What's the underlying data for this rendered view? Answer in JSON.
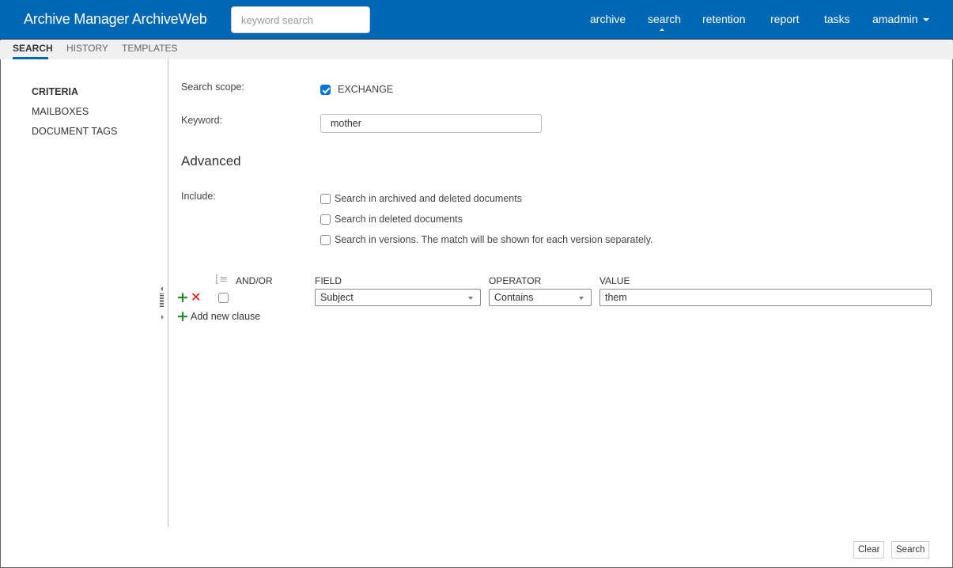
{
  "header": {
    "title": "Archive Manager ArchiveWeb",
    "search_placeholder": "keyword search",
    "nav": [
      "archive",
      "search",
      "retention",
      "report",
      "tasks"
    ],
    "active_nav": "search",
    "user": "amadmin",
    "brand_color": "#0067b4"
  },
  "subtabs": [
    "SEARCH",
    "HISTORY",
    "TEMPLATES"
  ],
  "active_subtab": "SEARCH",
  "sidebar": {
    "items": [
      "CRITERIA",
      "MAILBOXES",
      "DOCUMENT TAGS"
    ],
    "active": "CRITERIA"
  },
  "form": {
    "scope_label": "Search scope:",
    "scope_option": "EXCHANGE",
    "scope_checked": true,
    "keyword_label": "Keyword:",
    "keyword_value": "mother",
    "advanced_heading": "Advanced",
    "include_label": "Include:",
    "include_options": [
      {
        "label": "Search in archived and deleted documents",
        "checked": false
      },
      {
        "label": "Search in deleted documents",
        "checked": false
      },
      {
        "label": "Search in versions. The match will be shown for each version separately.",
        "checked": false
      }
    ]
  },
  "clauses": {
    "headers": {
      "andor": "AND/OR",
      "field": "FIELD",
      "operator": "OPERATOR",
      "value": "VALUE"
    },
    "rows": [
      {
        "checked": false,
        "field": "Subject",
        "operator": "Contains",
        "value": "them"
      }
    ],
    "add_label": "Add new clause"
  },
  "footer": {
    "clear_label": "Clear",
    "search_label": "Search"
  }
}
